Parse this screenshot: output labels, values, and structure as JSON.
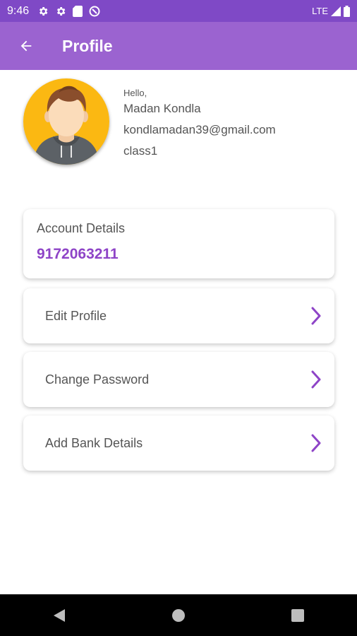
{
  "status_bar": {
    "time": "9:46",
    "network": "LTE",
    "icons": [
      "settings-icon",
      "settings-icon",
      "sd-card-icon",
      "data-saver-icon",
      "signal-icon",
      "battery-icon"
    ]
  },
  "app_bar": {
    "title": "Profile",
    "back_icon": "arrow-back-icon",
    "color": "#9b63d0"
  },
  "profile": {
    "greeting": "Hello,",
    "name": "Madan Kondla",
    "email": "kondlamadan39@gmail.com",
    "class": "class1",
    "avatar_icon": "user-avatar"
  },
  "account": {
    "label": "Account Details",
    "number": "9172063211",
    "accent_color": "#8e44c7"
  },
  "menu": {
    "items": [
      {
        "label": "Edit Profile",
        "icon": "chevron-right-icon"
      },
      {
        "label": "Change Password",
        "icon": "chevron-right-icon"
      },
      {
        "label": "Add Bank Details",
        "icon": "chevron-right-icon"
      }
    ]
  },
  "nav_bar": {
    "buttons": [
      "back-triangle-icon",
      "home-circle-icon",
      "recents-square-icon"
    ]
  }
}
